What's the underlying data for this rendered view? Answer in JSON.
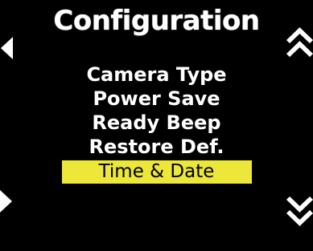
{
  "screen": {
    "title": "Configuration"
  },
  "menu": {
    "items": [
      {
        "label": "Camera Type"
      },
      {
        "label": "Power Save"
      },
      {
        "label": "Ready Beep"
      },
      {
        "label": "Restore Def."
      },
      {
        "label": "Time & Date"
      }
    ],
    "selected_index": 4
  },
  "nav": {
    "left_icon": "left-arrow-icon",
    "right_icon": "right-arrow-icon",
    "up_icon": "double-chevron-up-icon",
    "down_icon": "double-chevron-down-icon"
  },
  "colors": {
    "background": "#000000",
    "text": "#ffffff",
    "highlight": "#ede739",
    "highlight_text": "#000000"
  }
}
